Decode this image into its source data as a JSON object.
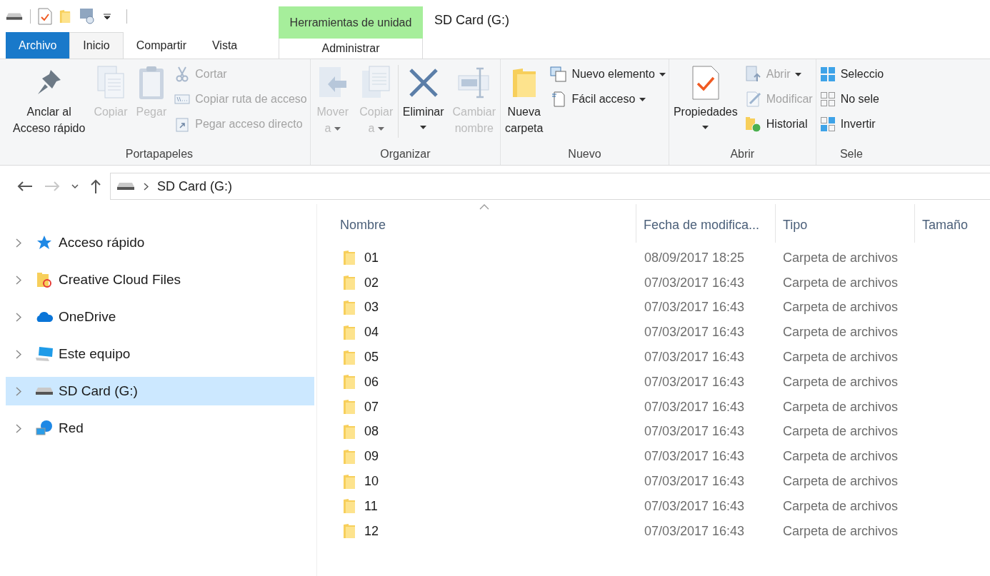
{
  "window": {
    "title": "SD Card (G:)",
    "context_label": "Herramientas de unidad"
  },
  "tabs": [
    {
      "label": "Archivo",
      "kind": "file",
      "selected": false
    },
    {
      "label": "Inicio",
      "kind": "normal",
      "selected": true
    },
    {
      "label": "Compartir",
      "kind": "normal",
      "selected": false
    },
    {
      "label": "Vista",
      "kind": "normal",
      "selected": false
    },
    {
      "label": "Administrar",
      "kind": "contextual",
      "selected": false
    }
  ],
  "ribbon": [
    {
      "label": "Portapapeles",
      "items": [
        {
          "kind": "large",
          "lines": [
            "Anclar al",
            "Acceso rápido"
          ],
          "disabled": false,
          "dropdown": false
        },
        {
          "kind": "large",
          "lines": [
            "Copiar"
          ],
          "disabled": true,
          "dropdown": false
        },
        {
          "kind": "large",
          "lines": [
            "Pegar"
          ],
          "disabled": true,
          "dropdown": false
        },
        {
          "kind": "small",
          "entries": [
            {
              "label": "Cortar",
              "disabled": true,
              "dropdown": false
            },
            {
              "label": "Copiar ruta de acceso",
              "disabled": true,
              "dropdown": false
            },
            {
              "label": "Pegar acceso directo",
              "disabled": true,
              "dropdown": false
            }
          ]
        }
      ]
    },
    {
      "label": "Organizar",
      "items": [
        {
          "kind": "large",
          "lines": [
            "Mover",
            "a"
          ],
          "disabled": true,
          "dropdown": true
        },
        {
          "kind": "large",
          "lines": [
            "Copiar",
            "a"
          ],
          "disabled": true,
          "dropdown": true
        },
        {
          "kind": "large",
          "lines": [
            "Eliminar"
          ],
          "disabled": false,
          "dropdown": true
        },
        {
          "kind": "large",
          "lines": [
            "Cambiar",
            "nombre"
          ],
          "disabled": true,
          "dropdown": false
        }
      ]
    },
    {
      "label": "Nuevo",
      "items": [
        {
          "kind": "large",
          "lines": [
            "Nueva",
            "carpeta"
          ],
          "disabled": false,
          "dropdown": false
        },
        {
          "kind": "small",
          "entries": [
            {
              "label": "Nuevo elemento",
              "disabled": false,
              "dropdown": true
            },
            {
              "label": "Fácil acceso",
              "disabled": false,
              "dropdown": true
            }
          ]
        }
      ]
    },
    {
      "label": "Abrir",
      "items": [
        {
          "kind": "large",
          "lines": [
            "Propiedades"
          ],
          "disabled": false,
          "dropdown": true
        },
        {
          "kind": "small",
          "entries": [
            {
              "label": "Abrir",
              "disabled": true,
              "dropdown": true
            },
            {
              "label": "Modificar",
              "disabled": true,
              "dropdown": false
            },
            {
              "label": "Historial",
              "disabled": false,
              "dropdown": false
            }
          ]
        }
      ]
    },
    {
      "label": "Sele",
      "items": [
        {
          "kind": "small",
          "entries": [
            {
              "label": "Seleccio",
              "disabled": false,
              "dropdown": false
            },
            {
              "label": "No sele",
              "disabled": false,
              "dropdown": false
            },
            {
              "label": "Invertir",
              "disabled": false,
              "dropdown": false
            }
          ]
        }
      ]
    }
  ],
  "address": {
    "path": [
      "SD Card (G:)"
    ]
  },
  "navigation": [
    {
      "label": "Acceso rápido",
      "selected": false
    },
    {
      "label": "Creative Cloud Files",
      "selected": false
    },
    {
      "label": "OneDrive",
      "selected": false
    },
    {
      "label": "Este equipo",
      "selected": false
    },
    {
      "label": "SD Card (G:)",
      "selected": true
    },
    {
      "label": "Red",
      "selected": false
    }
  ],
  "table": {
    "columns": [
      "Nombre",
      "Fecha de modifica...",
      "Tipo",
      "Tamaño"
    ],
    "rows": [
      {
        "name": "01",
        "date": "08/09/2017 18:25",
        "type": "Carpeta de archivos"
      },
      {
        "name": "02",
        "date": "07/03/2017 16:43",
        "type": "Carpeta de archivos"
      },
      {
        "name": "03",
        "date": "07/03/2017 16:43",
        "type": "Carpeta de archivos"
      },
      {
        "name": "04",
        "date": "07/03/2017 16:43",
        "type": "Carpeta de archivos"
      },
      {
        "name": "05",
        "date": "07/03/2017 16:43",
        "type": "Carpeta de archivos"
      },
      {
        "name": "06",
        "date": "07/03/2017 16:43",
        "type": "Carpeta de archivos"
      },
      {
        "name": "07",
        "date": "07/03/2017 16:43",
        "type": "Carpeta de archivos"
      },
      {
        "name": "08",
        "date": "07/03/2017 16:43",
        "type": "Carpeta de archivos"
      },
      {
        "name": "09",
        "date": "07/03/2017 16:43",
        "type": "Carpeta de archivos"
      },
      {
        "name": "10",
        "date": "07/03/2017 16:43",
        "type": "Carpeta de archivos"
      },
      {
        "name": "11",
        "date": "07/03/2017 16:43",
        "type": "Carpeta de archivos"
      },
      {
        "name": "12",
        "date": "07/03/2017 16:43",
        "type": "Carpeta de archivos"
      }
    ]
  }
}
